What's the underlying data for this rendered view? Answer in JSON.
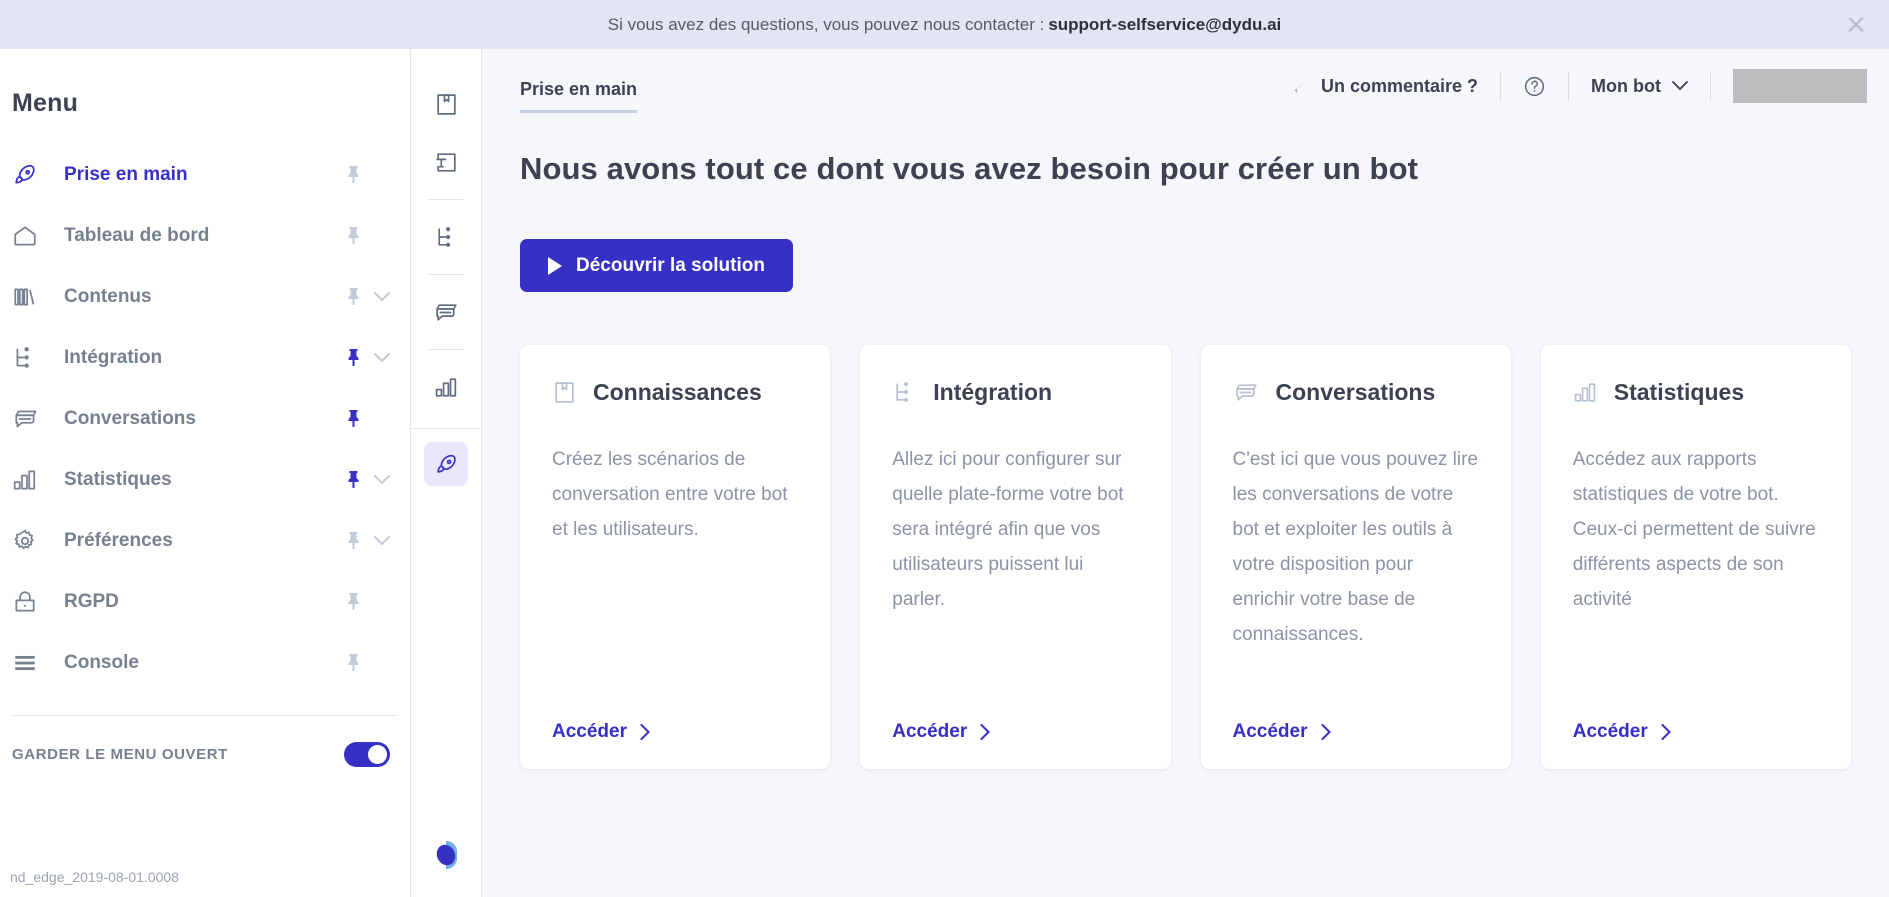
{
  "banner": {
    "text": "Si vous avez des questions, vous pouvez nous contacter :",
    "email": "support-selfservice@dydu.ai",
    "close_icon": "close-icon"
  },
  "sidebar": {
    "title": "Menu",
    "items": [
      {
        "label": "Prise en main",
        "icon": "rocket-icon",
        "active": true,
        "pinned": false,
        "chevron": false
      },
      {
        "label": "Tableau de bord",
        "icon": "home-icon",
        "active": false,
        "pinned": false,
        "chevron": false
      },
      {
        "label": "Contenus",
        "icon": "books-icon",
        "active": false,
        "pinned": false,
        "chevron": true
      },
      {
        "label": "Intégration",
        "icon": "integration-icon",
        "active": false,
        "pinned": true,
        "chevron": true
      },
      {
        "label": "Conversations",
        "icon": "conversation-icon",
        "active": false,
        "pinned": true,
        "chevron": false
      },
      {
        "label": "Statistiques",
        "icon": "bar-chart-icon",
        "active": false,
        "pinned": true,
        "chevron": true
      },
      {
        "label": "Préférences",
        "icon": "gear-icon",
        "active": false,
        "pinned": false,
        "chevron": true
      },
      {
        "label": "RGPD",
        "icon": "lock-icon",
        "active": false,
        "pinned": false,
        "chevron": false
      },
      {
        "label": "Console",
        "icon": "console-icon",
        "active": false,
        "pinned": false,
        "chevron": false
      }
    ],
    "keep_open_label": "GARDER LE MENU OUVERT",
    "keep_open_on": true,
    "version": "nd_edge_2019-08-01.0008"
  },
  "rail": {
    "items": [
      {
        "icon": "knowledge-icon",
        "active": false
      },
      {
        "icon": "text-box-icon",
        "active": false
      },
      {
        "icon": "integration-icon",
        "active": false
      },
      {
        "icon": "conversation-icon",
        "active": false
      },
      {
        "icon": "bar-chart-icon",
        "active": false
      },
      {
        "icon": "rocket-icon",
        "active": true
      }
    ],
    "logo": "dydu-logo"
  },
  "topbar": {
    "breadcrumb": "Prise en main",
    "feedback_label": "Un commentaire ?",
    "feedback_icon": "paper-plane-icon",
    "help_icon": "help-circle-icon",
    "bot_label": "Mon bot",
    "bot_chevron_icon": "chevron-down-icon",
    "avatar": "avatar-placeholder"
  },
  "main": {
    "page_title": "Nous avons tout ce dont vous avez besoin pour créer un bot",
    "cta_label": "Découvrir la solution",
    "cta_icon": "play-icon",
    "cards": [
      {
        "title": "Connaissances",
        "icon": "knowledge-icon",
        "desc": "Créez les scénarios de conversation entre votre bot et les utilisateurs.",
        "link": "Accéder",
        "link_icon": "chevron-right-icon"
      },
      {
        "title": "Intégration",
        "icon": "integration-icon",
        "desc": "Allez ici pour configurer sur quelle plate-forme votre bot sera intégré afin que vos utilisateurs puissent lui parler.",
        "link": "Accéder",
        "link_icon": "chevron-right-icon"
      },
      {
        "title": "Conversations",
        "icon": "conversation-icon",
        "desc": "C'est ici que vous pouvez lire les conversations de votre bot et exploiter les outils à votre disposition pour enrichir votre base de connaissances.",
        "link": "Accéder",
        "link_icon": "chevron-right-icon"
      },
      {
        "title": "Statistiques",
        "icon": "bar-chart-icon",
        "desc": "Accédez aux rapports statistiques de votre bot. Ceux-ci permettent de suivre différents aspects de son activité",
        "link": "Accéder",
        "link_icon": "chevron-right-icon"
      }
    ]
  },
  "colors": {
    "accent": "#3730c4",
    "banner_bg": "#e4e5f4",
    "main_bg": "#f6f7fa",
    "muted_text": "#8b94a6",
    "pin_active": "#3730c4",
    "pin_inactive": "#c3cbdb"
  }
}
